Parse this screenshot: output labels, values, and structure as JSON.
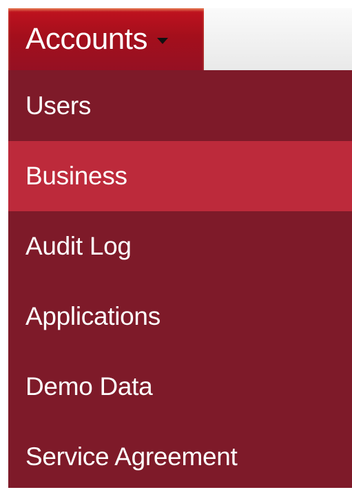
{
  "dropdown": {
    "trigger_label": "Accounts",
    "items": [
      {
        "label": "Users"
      },
      {
        "label": "Business",
        "active": true
      },
      {
        "label": "Audit Log"
      },
      {
        "label": "Applications"
      },
      {
        "label": "Demo Data"
      },
      {
        "label": "Service Agreement"
      }
    ]
  },
  "colors": {
    "menu_background": "#7e1a29",
    "active_item": "#bd2a3b",
    "trigger": "#b3111e",
    "text": "#ffffff"
  }
}
